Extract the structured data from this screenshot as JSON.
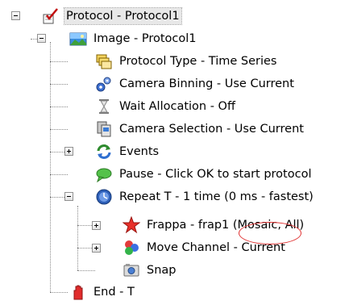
{
  "tree": {
    "nodes": [
      {
        "label": "Protocol - Protocol1",
        "icon": "protocol-check-icon",
        "toggle": "minus"
      },
      {
        "label": "Image - Protocol1",
        "icon": "image-landscape-icon",
        "toggle": "minus"
      },
      {
        "label": "Protocol Type - Time Series",
        "icon": "stack-folders-icon",
        "toggle": "none"
      },
      {
        "label": "Camera Binning - Use Current",
        "icon": "gears-icon",
        "toggle": "none"
      },
      {
        "label": "Wait Allocation - Off",
        "icon": "hourglass-icon",
        "toggle": "none"
      },
      {
        "label": "Camera Selection - Use Current",
        "icon": "camera-stack-icon",
        "toggle": "none"
      },
      {
        "label": "Events",
        "icon": "refresh-arrows-icon",
        "toggle": "plus"
      },
      {
        "label": "Pause - Click OK to start protocol",
        "icon": "speech-bubble-icon",
        "toggle": "none"
      },
      {
        "label": "Repeat T - 1 time (0 ms - fastest)",
        "icon": "clock-globe-icon",
        "toggle": "minus"
      },
      {
        "label": "Frappa - frap1 (Mosaic, All)",
        "icon": "star-icon",
        "toggle": "plus"
      },
      {
        "label": "Move Channel - Current",
        "icon": "rgb-circles-icon",
        "toggle": "plus"
      },
      {
        "label": "Snap",
        "icon": "camera-icon",
        "toggle": "none"
      },
      {
        "label": "End - T",
        "icon": "stop-hand-icon",
        "toggle": "none"
      }
    ]
  },
  "colors": {
    "annotation_circle": "#e03030",
    "connector": "#8a8a8a"
  }
}
